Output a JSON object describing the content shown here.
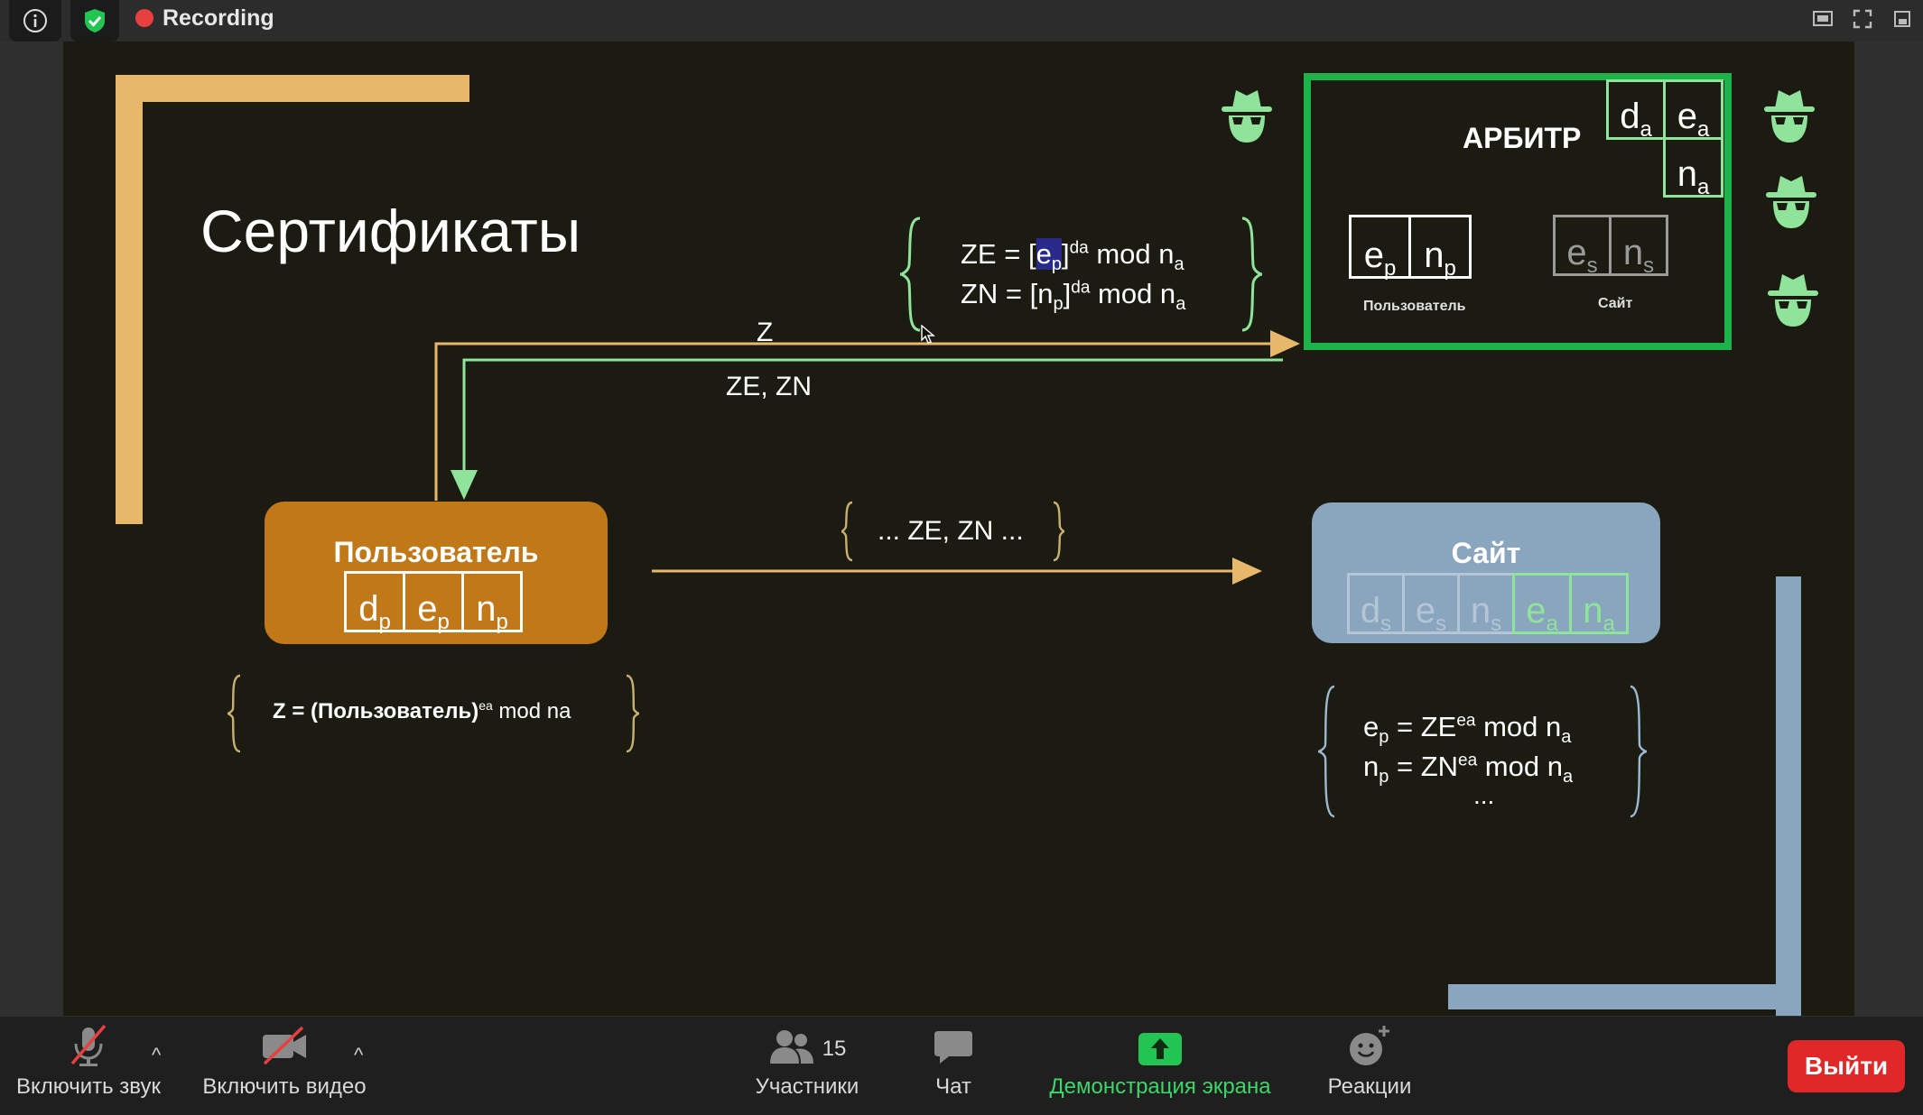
{
  "topbar": {
    "recording_label": "Recording"
  },
  "slide": {
    "title": "Сертификаты",
    "arbiter": {
      "title": "АРБИТР",
      "key_cells": [
        [
          "d",
          "a"
        ],
        [
          "e",
          "a"
        ],
        [
          "n",
          "a"
        ]
      ],
      "user_cells": [
        [
          "e",
          "p"
        ],
        [
          "n",
          "p"
        ]
      ],
      "user_caption": "Пользователь",
      "site_cells": [
        [
          "e",
          "s"
        ],
        [
          "n",
          "s"
        ]
      ],
      "site_caption": "Сайт"
    },
    "formula_top": {
      "line1": {
        "a": "ZE = [",
        "b": "e",
        "b_sub": "p",
        "c": "]",
        "d_sup": "da",
        "e": " mod n",
        "e_sub": "a"
      },
      "line2": {
        "a": "ZN = [n",
        "a_sub": "p",
        "c": "]",
        "d_sup": "da",
        "e": " mod n",
        "e_sub": "a"
      }
    },
    "arrow_z_label": "Z",
    "arrow_zezn_label": "ZE, ZN",
    "middle_label": "... ZE, ZN ...",
    "user_node": {
      "label": "Пользователь",
      "cells": [
        [
          "d",
          "p"
        ],
        [
          "e",
          "p"
        ],
        [
          "n",
          "p"
        ]
      ]
    },
    "site_node": {
      "label": "Сайт",
      "cells": [
        [
          "d",
          "s"
        ],
        [
          "e",
          "s"
        ],
        [
          "n",
          "s"
        ],
        [
          "e",
          "a"
        ],
        [
          "n",
          "a"
        ]
      ]
    },
    "formula_user": {
      "bold": "Z = (Пользователь)",
      "sup": "ea",
      "rest": " mod na"
    },
    "formula_site": {
      "line1": {
        "a": "e",
        "a_sub": "p",
        "b": " = ZE",
        "b_sup": "ea",
        "c": " mod n",
        "c_sub": "a"
      },
      "line2": {
        "a": "n",
        "a_sub": "p",
        "b": " = ZN",
        "b_sup": "ea",
        "c": " mod n",
        "c_sub": "a"
      },
      "line3": "..."
    }
  },
  "toolbar": {
    "audio_label": "Включить звук",
    "video_label": "Включить видео",
    "participants_count": "15",
    "participants_label": "Участники",
    "chat_label": "Чат",
    "share_label": "Демонстрация экрана",
    "reactions_label": "Реакции",
    "leave_label": "Выйти"
  },
  "colors": {
    "accent_green": "#1db34a",
    "orange": "#c17819",
    "site_blue": "#8aa6bf",
    "leave_red": "#e02828",
    "recording_red": "#e8403f"
  }
}
